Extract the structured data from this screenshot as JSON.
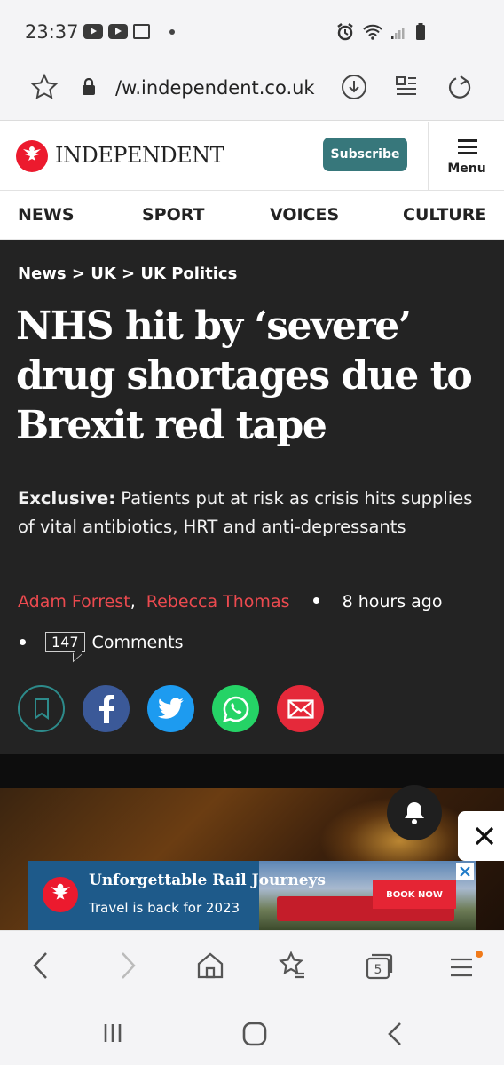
{
  "status_bar": {
    "time": "23:37"
  },
  "url_bar": {
    "url": "/w.independent.co.uk"
  },
  "header": {
    "logo_text": "INDEPENDENT",
    "subscribe_label": "Subscribe",
    "menu_label": "Menu"
  },
  "section_nav": {
    "items": [
      "NEWS",
      "SPORT",
      "VOICES",
      "CULTURE"
    ]
  },
  "article": {
    "breadcrumb": "News > UK > UK Politics",
    "headline": "NHS hit by ‘severe’ drug shortages due to Brexit red tape",
    "standfirst_label": "Exclusive:",
    "standfirst_text": " Patients put at risk as crisis hits supplies of vital antibiotics, HRT and anti-depressants",
    "authors": [
      "Adam Forrest",
      "Rebecca Thomas"
    ],
    "author_separator": ",",
    "published": "8 hours ago",
    "comment_count": "147",
    "comments_label": "Comments"
  },
  "share": {
    "icons": [
      "bookmark-icon",
      "facebook-icon",
      "twitter-icon",
      "whatsapp-icon",
      "email-icon"
    ],
    "colors": {
      "facebook": "#3b5998",
      "twitter": "#1d9bf0",
      "whatsapp": "#25d366",
      "email": "#e5293a",
      "bookmark": "#2d8b8b"
    }
  },
  "ad": {
    "title": "Unforgettable Rail Journeys",
    "subtitle": "Travel is back for 2023",
    "cta": "BOOK NOW"
  },
  "colors": {
    "brand_red": "#ec1a2e",
    "subscribe": "#37777b",
    "hero_bg": "#232323",
    "author_red": "#ec4a4f"
  }
}
